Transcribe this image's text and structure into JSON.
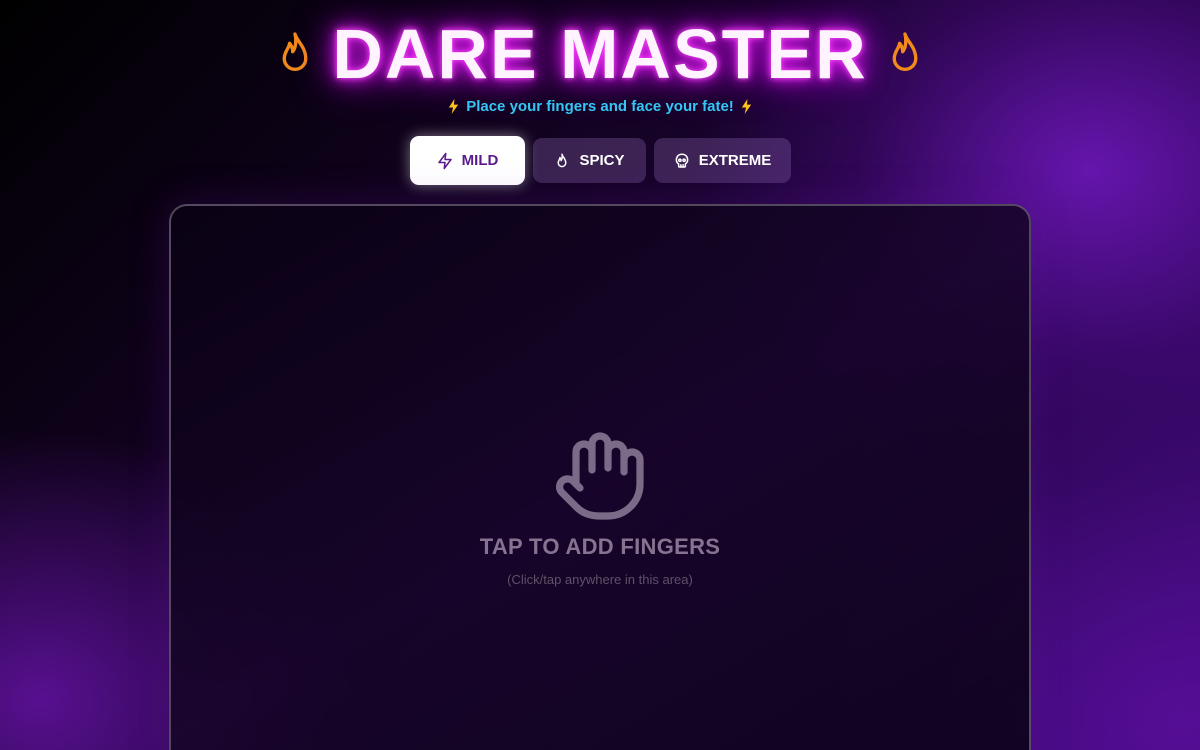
{
  "app": {
    "title": "DARE MASTER",
    "subtitle": "Place your fingers and face your fate!"
  },
  "icons": {
    "title_left": "flame-icon",
    "title_right": "flame-icon",
    "subtitle_left": "lightning-icon",
    "subtitle_right": "lightning-icon",
    "play_area": "hand-icon"
  },
  "modes": [
    {
      "label": "MILD",
      "icon": "zap-icon",
      "selected": true
    },
    {
      "label": "SPICY",
      "icon": "flame-icon",
      "selected": false
    },
    {
      "label": "EXTREME",
      "icon": "skull-icon",
      "selected": false
    }
  ],
  "play_area": {
    "prompt": "TAP TO ADD FINGERS",
    "hint": "(Click/tap anywhere in this area)"
  },
  "colors": {
    "title_glow": "#e21cf0",
    "subtitle": "#34c7f5",
    "flame": "#f28a1a",
    "active_tab_text": "#5b1a8f"
  }
}
